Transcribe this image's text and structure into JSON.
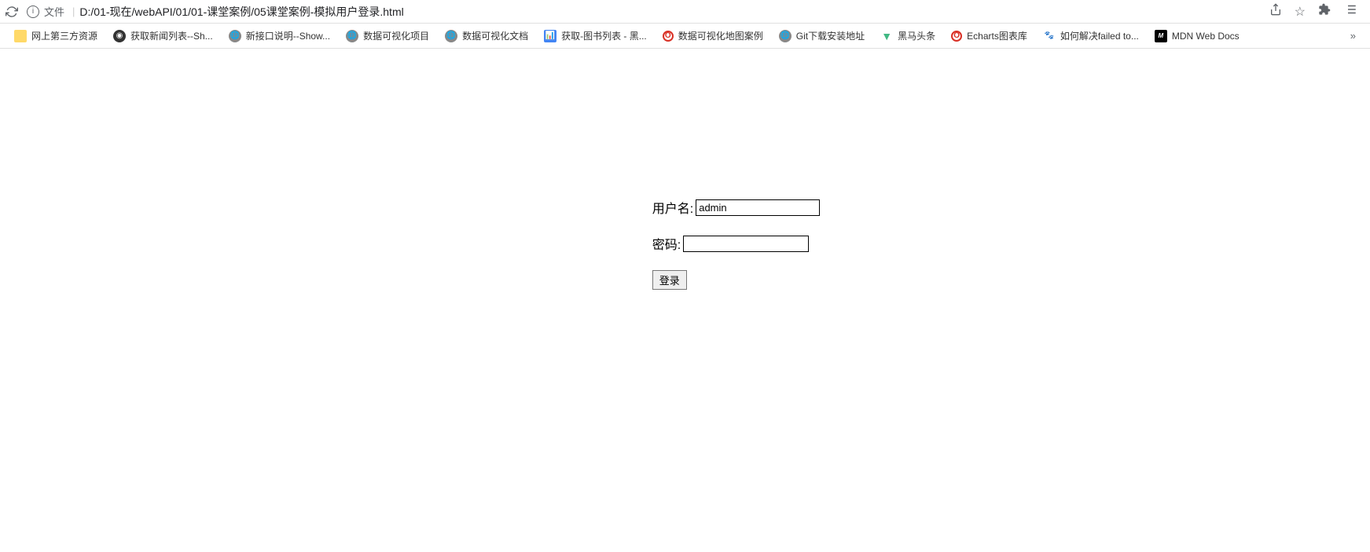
{
  "browser": {
    "file_label": "文件",
    "url": "D:/01-现在/webAPI/01/01-课堂案例/05课堂案例-模拟用户登录.html"
  },
  "bookmarks": [
    {
      "label": "网上第三方资源",
      "icon_type": "folder"
    },
    {
      "label": "获取新闻列表--Sh...",
      "icon_type": "globe-dark"
    },
    {
      "label": "新接口说明--Show...",
      "icon_type": "globe-gray"
    },
    {
      "label": "数据可视化项目",
      "icon_type": "globe-gray"
    },
    {
      "label": "数据可视化文档",
      "icon_type": "globe-gray"
    },
    {
      "label": "获取-图书列表 - 黑...",
      "icon_type": "blue"
    },
    {
      "label": "数据可视化地图案例",
      "icon_type": "red-circle"
    },
    {
      "label": "Git下载安装地址",
      "icon_type": "globe-gray"
    },
    {
      "label": "黑马头条",
      "icon_type": "green-v"
    },
    {
      "label": "Echarts图表库",
      "icon_type": "red-circle"
    },
    {
      "label": "如何解决failed to...",
      "icon_type": "paw"
    },
    {
      "label": "MDN Web Docs",
      "icon_type": "mdn"
    }
  ],
  "form": {
    "username_label": "用户名:",
    "username_value": "admin",
    "password_label": "密码:",
    "password_value": "",
    "submit_label": "登录"
  }
}
